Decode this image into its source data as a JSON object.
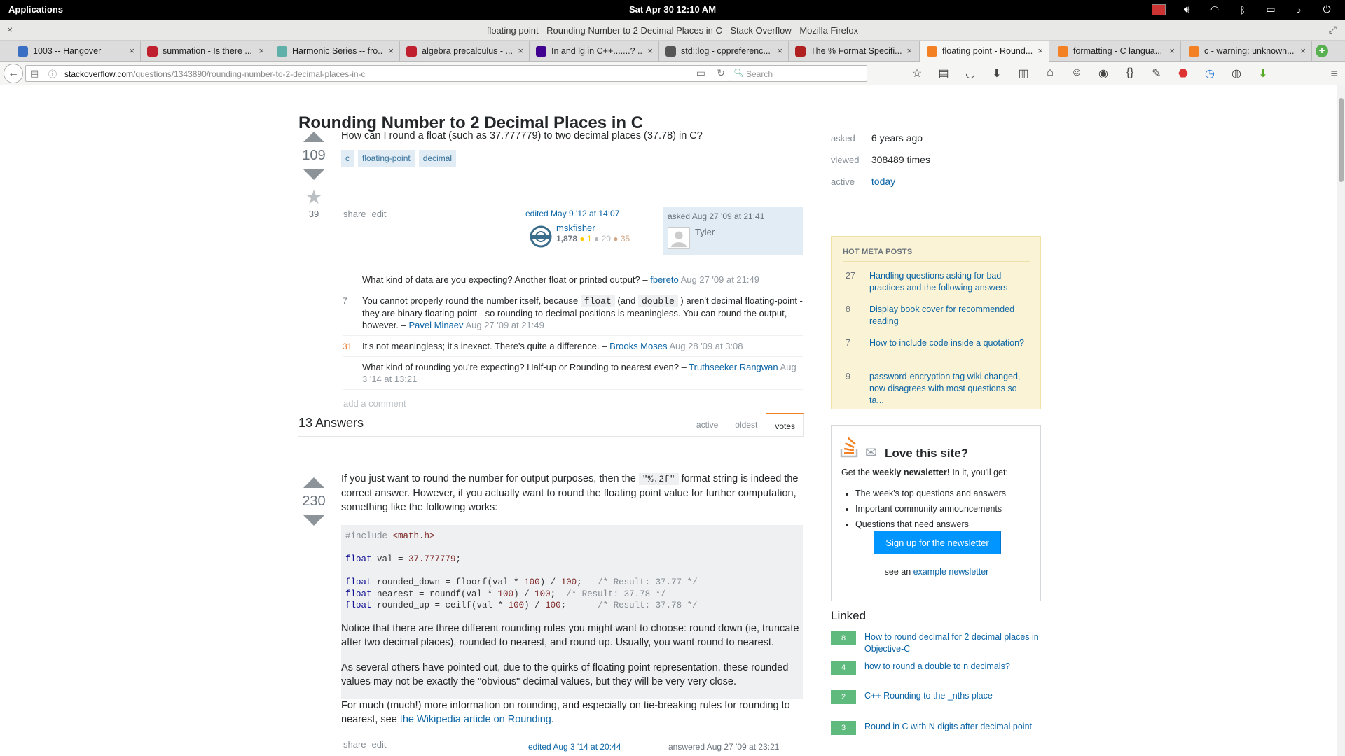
{
  "system": {
    "apps_label": "Applications",
    "clock": "Sat Apr 30    12:10 AM"
  },
  "window": {
    "title": "floating point - Rounding Number to 2 Decimal Places in C - Stack Overflow - Mozilla Firefox"
  },
  "tabs": [
    {
      "label": "1003 -- Hangover",
      "fav_color": "#3b6fc4"
    },
    {
      "label": "summation - Is there ...",
      "fav_color": "#c0202d"
    },
    {
      "label": "Harmonic Series -- fro...",
      "fav_color": "#5fb0a8"
    },
    {
      "label": "algebra precalculus - ...",
      "fav_color": "#c0202d"
    },
    {
      "label": "In and lg in C++.......? ...",
      "fav_color": "#400090"
    },
    {
      "label": "std::log - cppreferenc...",
      "fav_color": "#555555"
    },
    {
      "label": "The % Format Specifi...",
      "fav_color": "#b02020"
    },
    {
      "label": "floating point - Round...",
      "fav_color": "#f48024"
    },
    {
      "label": "formatting - C langua...",
      "fav_color": "#f48024"
    },
    {
      "label": "c - warning: unknown...",
      "fav_color": "#f48024"
    }
  ],
  "url": {
    "host": "stackoverflow.com",
    "path": "/questions/1343890/rounding-number-to-2-decimal-places-in-c"
  },
  "search": {
    "placeholder": "Search"
  },
  "question": {
    "title": "Rounding Number to 2 Decimal Places in C",
    "votes": "109",
    "favorites": "39",
    "body": "How can I round a float (such as 37.777779) to two decimal places (37.78) in C?",
    "tags": [
      "c",
      "floating-point",
      "decimal"
    ],
    "menu": {
      "share": "share",
      "edit": "edit"
    },
    "edited": {
      "action": "edited May 9 '12 at 14:07",
      "user": "mskfisher",
      "rep": "1,878",
      "gold": "● 1",
      "silver": "● 20",
      "bronze": "● 35"
    },
    "asked": {
      "action": "asked Aug 27 '09 at 21:41",
      "user": "Tyler"
    },
    "comments": [
      {
        "score": "",
        "text": "What kind of data are you expecting? Another float or printed output? – ",
        "user": "fbereto",
        "date": "Aug 27 '09 at 21:49"
      },
      {
        "score": "7",
        "text_a": "You cannot properly round the number itself, because ",
        "code1": "float",
        "text_b": " (and ",
        "code2": "double",
        "text_c": " ) aren't decimal floating-point - they are binary floating-point - so rounding to decimal positions is meaningless. You can round the output, however. – ",
        "user": "Pavel Minaev",
        "date": "Aug 27 '09 at 21:49"
      },
      {
        "score": "31",
        "text": "It's not meaningless; it's inexact. There's quite a difference. – ",
        "user": "Brooks Moses",
        "date": "Aug 28 '09 at 3:08"
      },
      {
        "score": "",
        "text": "What kind of rounding you're expecting? Half-up or Rounding to nearest even? – ",
        "user": "Truthseeker Rangwan",
        "date": "Aug 3 '14 at 13:21"
      }
    ],
    "add_comment": "add a comment"
  },
  "answers": {
    "count_label": "13 Answers",
    "tabs": [
      "active",
      "oldest",
      "votes"
    ],
    "first": {
      "votes": "230",
      "p1_a": "If you just want to round the number for output purposes, then the ",
      "p1_code": "\"%.2f\"",
      "p1_b": " format string is indeed the correct answer. However, if you actually want to round the floating point value for further computation, something like the following works:",
      "code": {
        "include_kw": "#include",
        "include_arg": "<math.h>",
        "l2_kw": "float",
        "l2_rest": " val = ",
        "l2_num": "37.777779",
        "l2_end": ";",
        "l3_kw": "float",
        "l3_rest": " rounded_down = floorf(val * ",
        "l3_n1": "100",
        "l3_mid": ") / ",
        "l3_n2": "100",
        "l3_end": ";   ",
        "l3_com": "/* Result: 37.77 */",
        "l4_kw": "float",
        "l4_rest": " nearest = roundf(val * ",
        "l4_n1": "100",
        "l4_mid": ") / ",
        "l4_n2": "100",
        "l4_end": ";  ",
        "l4_com": "/* Result: 37.78 */",
        "l5_kw": "float",
        "l5_rest": " rounded_up = ceilf(val * ",
        "l5_n1": "100",
        "l5_mid": ") / ",
        "l5_n2": "100",
        "l5_end": ";      ",
        "l5_com": "/* Result: 37.78 */"
      },
      "p2": "Notice that there are three different rounding rules you might want to choose: round down (ie, truncate after two decimal places), rounded to nearest, and round up. Usually, you want round to nearest.",
      "p3": "As several others have pointed out, due to the quirks of floating point representation, these rounded values may not be exactly the \"obvious\" decimal values, but they will be very very close.",
      "p4_a": "For much (much!) more information on rounding, and especially on tie-breaking rules for rounding to nearest, see ",
      "p4_link": "the Wikipedia article on Rounding",
      "p4_b": ".",
      "menu": {
        "share": "share",
        "edit": "edit"
      },
      "edited": "edited Aug 3 '14 at 20:44",
      "answered": "answered Aug 27 '09 at 23:21"
    }
  },
  "sidebar": {
    "stats": [
      {
        "k": "asked",
        "v": "6 years ago"
      },
      {
        "k": "viewed",
        "v": "308489 times"
      },
      {
        "k": "active",
        "v": "today"
      }
    ],
    "meta_title": "HOT META POSTS",
    "meta": [
      {
        "n": "27",
        "t": "Handling questions asking for bad practices and the following answers"
      },
      {
        "n": "8",
        "t": "Display book cover for recommended reading"
      },
      {
        "n": "7",
        "t": "How to include code inside a quotation?"
      },
      {
        "n": "9",
        "t": "password-encryption tag wiki changed, now disagrees with most questions so ta..."
      }
    ],
    "newsletter": {
      "heading": "Love this site?",
      "sub_a": "Get the ",
      "sub_b": "weekly newsletter!",
      "sub_c": " In it, you'll get:",
      "items": [
        "The week's top questions and answers",
        "Important community announcements",
        "Questions that need answers"
      ],
      "button": "Sign up for the newsletter",
      "see_a": "see an ",
      "see_link": "example newsletter"
    },
    "linked_title": "Linked",
    "linked": [
      {
        "n": "8",
        "t": "How to round decimal for 2 decimal places in Objective-C"
      },
      {
        "n": "4",
        "t": "how to round a double to n decimals?"
      },
      {
        "n": "2",
        "t": "C++ Rounding to the _nths place"
      },
      {
        "n": "3",
        "t": "Round in C with N digits after decimal point"
      }
    ]
  }
}
